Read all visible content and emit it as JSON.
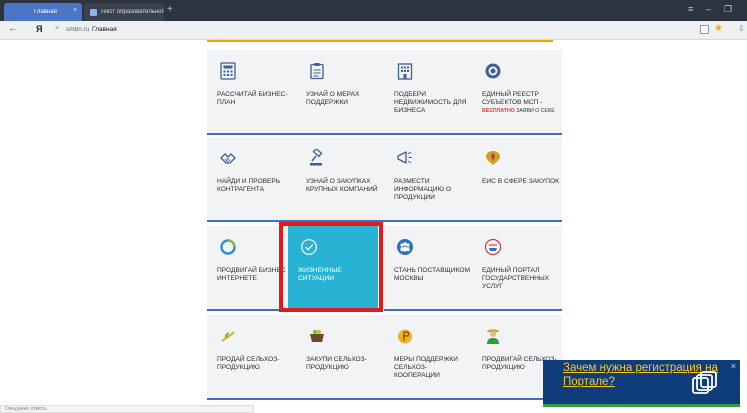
{
  "browser": {
    "tabs": [
      {
        "label": "Главная",
        "active": true
      },
      {
        "label": "Текст образовательного ...",
        "active": false
      }
    ],
    "new_tab": "+",
    "tab_close": "×",
    "window_controls": [
      "≡",
      "–",
      "❐"
    ],
    "yandex_logo": "Я",
    "clear_button": "×",
    "domain": "smbn.ru",
    "page_title": "Главная",
    "back_button": "←"
  },
  "tiles": [
    {
      "label": "РАССЧИТАЙ БИЗНЕС-ПЛАН",
      "icon": "calculator-icon"
    },
    {
      "label": "УЗНАЙ О МЕРАХ ПОДДЕРЖКИ",
      "icon": "clipboard-icon"
    },
    {
      "label": "ПОДБЕРИ НЕДВИЖИМОСТЬ ДЛЯ БИЗНЕСА",
      "icon": "building-icon"
    },
    {
      "label": "ЕДИНЫЙ РЕЕСТР СУБЪЕКТОВ МСП -",
      "sub_accent": "БЕСПЛАТНО",
      "sub_text": " ЗАЯВИ О СЕБЕ",
      "icon": "registry-seal-icon"
    },
    {
      "label": "НАЙДИ И ПРОВЕРЬ КОНТРАГЕНТА",
      "icon": "handshake-icon"
    },
    {
      "label": "УЗНАЙ О ЗАКУПКАХ КРУПНЫХ КОМПАНИЙ",
      "icon": "gavel-icon"
    },
    {
      "label": "РАЗМЕСТИ ИНФОРМАЦИЮ О ПРОДУКЦИИ",
      "icon": "megaphone-icon"
    },
    {
      "label": "ЕИС В СФЕРЕ ЗАКУПОК",
      "icon": "coat-of-arms-icon"
    },
    {
      "label": "ПРОДВИГАЙ БИЗНЕС В ИНТЕРНЕТЕ",
      "icon": "ring-icon"
    },
    {
      "label": "ЖИЗНЕННЫЕ СИТУАЦИИ",
      "icon": "check-circle-icon",
      "highlighted": true
    },
    {
      "label": "СТАНЬ ПОСТАВЩИКОМ МОСКВЫ",
      "icon": "people-circle-icon"
    },
    {
      "label": "ЕДИНЫЙ ПОРТАЛ ГОСУДАРСТВЕННЫХ УСЛУГ",
      "icon": "gosuslugi-icon"
    },
    {
      "label": "ПРОДАЙ СЕЛЬХОЗ-ПРОДУКЦИЮ",
      "icon": "sprout-icon"
    },
    {
      "label": "ЗАКУПИ СЕЛЬХОЗ-ПРОДУКЦИЮ",
      "icon": "basket-icon"
    },
    {
      "label": "МЕРЫ ПОДДЕРЖКИ СЕЛЬХОЗ-КООПЕРАЦИИ",
      "icon": "coin-icon"
    },
    {
      "label": "ПРОДВИГАЙ СЕЛЬХОЗ-ПРОДУКЦИЮ",
      "icon": "farmer-icon"
    }
  ],
  "status_bar": "Ожидание ответа...",
  "banner": {
    "link_text": "Зачем нужна регистрация на Портале?",
    "close": "×",
    "icon": "copy-windows-icon"
  },
  "colors": {
    "tile_bg": "#f2f3f5",
    "tile_underline": "#3b6fc9",
    "highlight": "#28b3d4",
    "red_frame": "#e11b1b",
    "top_accent": "#e7a800",
    "banner_bg": "#0f3c7a",
    "banner_link": "#ffc61a"
  }
}
